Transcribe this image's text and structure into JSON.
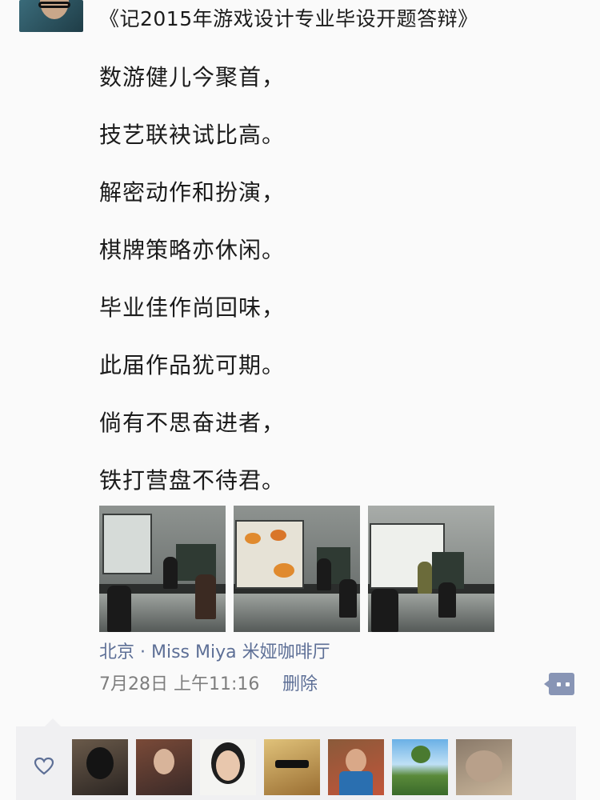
{
  "post": {
    "title": "《记2015年游戏设计专业毕设开题答辩》",
    "lines": [
      "数游健儿今聚首，",
      "技艺联袂试比高。",
      "解密动作和扮演，",
      "棋牌策略亦休闲。",
      "毕业佳作尚回味，",
      "此届作品犹可期。",
      "倘有不思奋进者，",
      "铁打营盘不待君。"
    ],
    "location": "北京 · Miss Miya 米娅咖啡厅",
    "timestamp": "7月28日 上午11:16",
    "delete_label": "删除"
  },
  "colors": {
    "link": "#5d6f96",
    "meta": "#7e7e7e",
    "comment_button": "#8895b5",
    "likes_bg": "#f0f0f2"
  },
  "icons": {
    "like": "heart-icon",
    "comment": "comment-icon"
  }
}
